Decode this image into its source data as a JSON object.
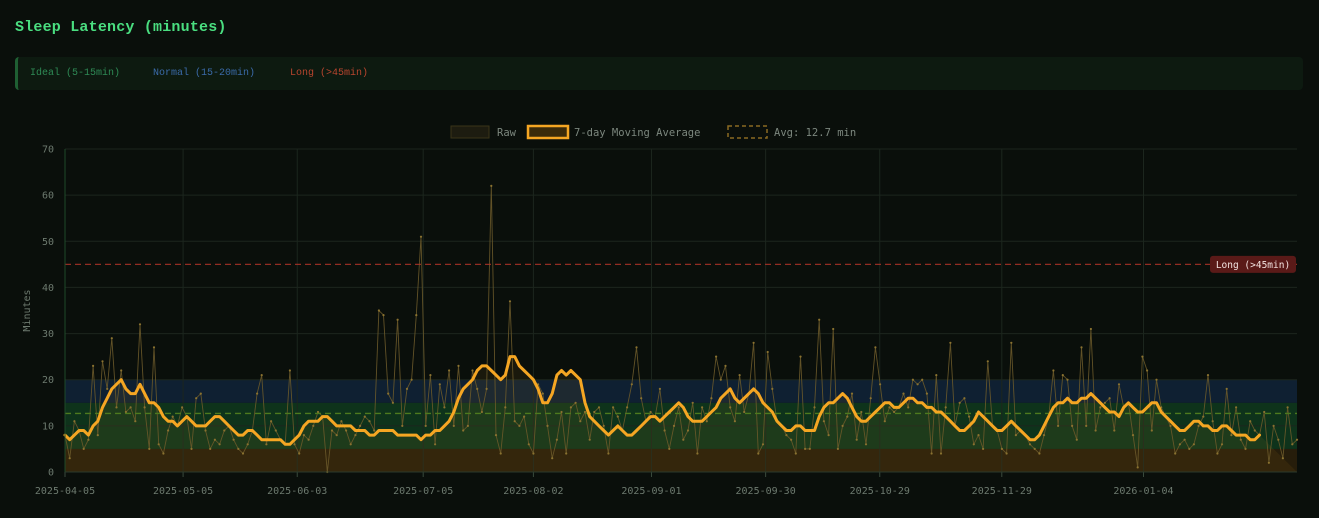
{
  "title": "Sleep Latency (minutes)",
  "zones_legend": {
    "ideal": "Ideal (5-15min)",
    "normal": "Normal (15-20min)",
    "long": "Long (>45min)"
  },
  "colors": {
    "accent": "#f5a623",
    "raw_line": "#6b5a2a",
    "ideal_zone": "#0f3a1f",
    "normal_zone": "#10233a",
    "low_zone": "#2b200c",
    "long_line": "#b4352a",
    "avg_line": "#4d7a1e"
  },
  "chart_data": {
    "type": "line",
    "ylabel": "Minutes",
    "ylim": [
      0,
      70
    ],
    "y_ticks": [
      0,
      10,
      20,
      30,
      40,
      50,
      60,
      70
    ],
    "x_start": "2025-04-05",
    "x_end": "2026-02-12",
    "x_tick_labels": [
      "2025-04-05",
      "2025-05-05",
      "2025-06-03",
      "2025-07-05",
      "2025-08-02",
      "2025-09-01",
      "2025-09-30",
      "2025-10-29",
      "2025-11-29",
      "2026-01-04"
    ],
    "legend": {
      "raw": "Raw",
      "moving_average": "7-day Moving Average",
      "average": "Avg: 12.7 min"
    },
    "average": 12.7,
    "threshold": {
      "value": 45,
      "label": "Long (>45min)"
    },
    "zones": [
      {
        "name": "Ideal",
        "from": 5,
        "to": 15
      },
      {
        "name": "Normal",
        "from": 15,
        "to": 20
      }
    ],
    "series": [
      {
        "name": "Raw",
        "values": [
          8,
          3,
          11,
          9,
          5,
          7,
          23,
          8,
          24,
          18,
          29,
          14,
          22,
          13,
          14,
          11,
          32,
          14,
          5,
          27,
          6,
          4,
          9,
          12,
          10,
          14,
          12,
          5,
          16,
          17,
          9,
          5,
          7,
          6,
          9,
          10,
          7,
          5,
          4,
          6,
          9,
          17,
          21,
          6,
          11,
          9,
          7,
          6,
          22,
          6,
          4,
          8,
          7,
          10,
          13,
          12,
          0,
          9,
          8,
          11,
          9,
          6,
          8,
          10,
          12,
          11,
          9,
          35,
          34,
          17,
          15,
          33,
          10,
          18,
          20,
          34,
          51,
          10,
          21,
          6,
          19,
          14,
          22,
          10,
          23,
          9,
          10,
          22,
          18,
          13,
          18,
          62,
          8,
          4,
          14,
          37,
          11,
          10,
          12,
          6,
          4,
          19,
          17,
          10,
          3,
          7,
          13,
          4,
          14,
          15,
          11,
          13,
          7,
          13,
          14,
          10,
          4,
          14,
          12,
          9,
          14,
          19,
          27,
          16,
          11,
          13,
          12,
          18,
          9,
          5,
          10,
          14,
          7,
          9,
          15,
          4,
          14,
          11,
          16,
          25,
          20,
          23,
          14,
          11,
          21,
          13,
          17,
          28,
          4,
          6,
          26,
          18,
          11,
          10,
          8,
          7,
          4,
          25,
          5,
          5,
          14,
          33,
          11,
          8,
          31,
          5,
          10,
          12,
          17,
          7,
          13,
          6,
          16,
          27,
          19,
          11,
          14,
          13,
          14,
          17,
          14,
          20,
          19,
          20,
          17,
          4,
          21,
          4,
          14,
          28,
          10,
          15,
          16,
          12,
          6,
          8,
          5,
          24,
          10,
          9,
          5,
          4,
          28,
          8,
          9,
          8,
          6,
          5,
          4,
          8,
          12,
          22,
          10,
          21,
          20,
          10,
          7,
          27,
          10,
          31,
          9,
          14,
          15,
          16,
          9,
          19,
          14,
          15,
          8,
          1,
          25,
          22,
          9,
          20,
          14,
          12,
          10,
          4,
          6,
          7,
          5,
          6,
          10,
          12,
          21,
          11,
          4,
          6,
          18,
          8,
          14,
          7,
          5,
          11,
          9,
          8,
          13,
          2,
          10,
          7,
          3,
          14,
          6,
          7
        ]
      },
      {
        "name": "7-day Moving Average",
        "values": [
          8,
          7,
          8,
          9,
          9,
          8,
          10,
          11,
          14,
          16,
          18,
          19,
          20,
          18,
          17,
          17,
          19,
          17,
          15,
          15,
          14,
          12,
          11,
          11,
          10,
          11,
          12,
          11,
          10,
          10,
          10,
          11,
          12,
          12,
          11,
          10,
          9,
          8,
          8,
          9,
          9,
          8,
          7,
          7,
          7,
          7,
          7,
          6,
          6,
          7,
          8,
          10,
          11,
          11,
          11,
          12,
          12,
          11,
          10,
          10,
          10,
          10,
          9,
          9,
          9,
          8,
          8,
          9,
          9,
          9,
          9,
          8,
          8,
          8,
          8,
          8,
          7,
          8,
          8,
          9,
          9,
          10,
          11,
          13,
          16,
          18,
          19,
          20,
          22,
          23,
          23,
          22,
          21,
          20,
          21,
          25,
          25,
          23,
          22,
          21,
          20,
          18,
          15,
          15,
          17,
          21,
          22,
          21,
          22,
          21,
          20,
          15,
          12,
          11,
          10,
          9,
          8,
          9,
          10,
          9,
          8,
          8,
          9,
          10,
          11,
          12,
          12,
          11,
          12,
          13,
          14,
          15,
          14,
          12,
          11,
          11,
          11,
          12,
          13,
          14,
          16,
          17,
          18,
          16,
          15,
          16,
          17,
          18,
          17,
          15,
          14,
          13,
          11,
          10,
          9,
          9,
          10,
          10,
          9,
          9,
          9,
          12,
          14,
          15,
          15,
          16,
          17,
          16,
          14,
          12,
          11,
          11,
          12,
          13,
          14,
          15,
          15,
          14,
          14,
          15,
          16,
          16,
          15,
          15,
          14,
          14,
          13,
          13,
          12,
          11,
          10,
          9,
          9,
          10,
          11,
          13,
          12,
          11,
          10,
          9,
          9,
          10,
          11,
          10,
          9,
          8,
          7,
          7,
          8,
          10,
          12,
          14,
          15,
          15,
          16,
          15,
          15,
          16,
          16,
          17,
          16,
          15,
          14,
          13,
          13,
          12,
          14,
          15,
          14,
          13,
          13,
          14,
          15,
          15,
          13,
          12,
          11,
          10,
          9,
          9,
          10,
          11,
          11,
          10,
          10,
          9,
          9,
          10,
          10,
          9,
          8,
          8,
          8,
          7,
          7,
          8
        ]
      }
    ]
  }
}
